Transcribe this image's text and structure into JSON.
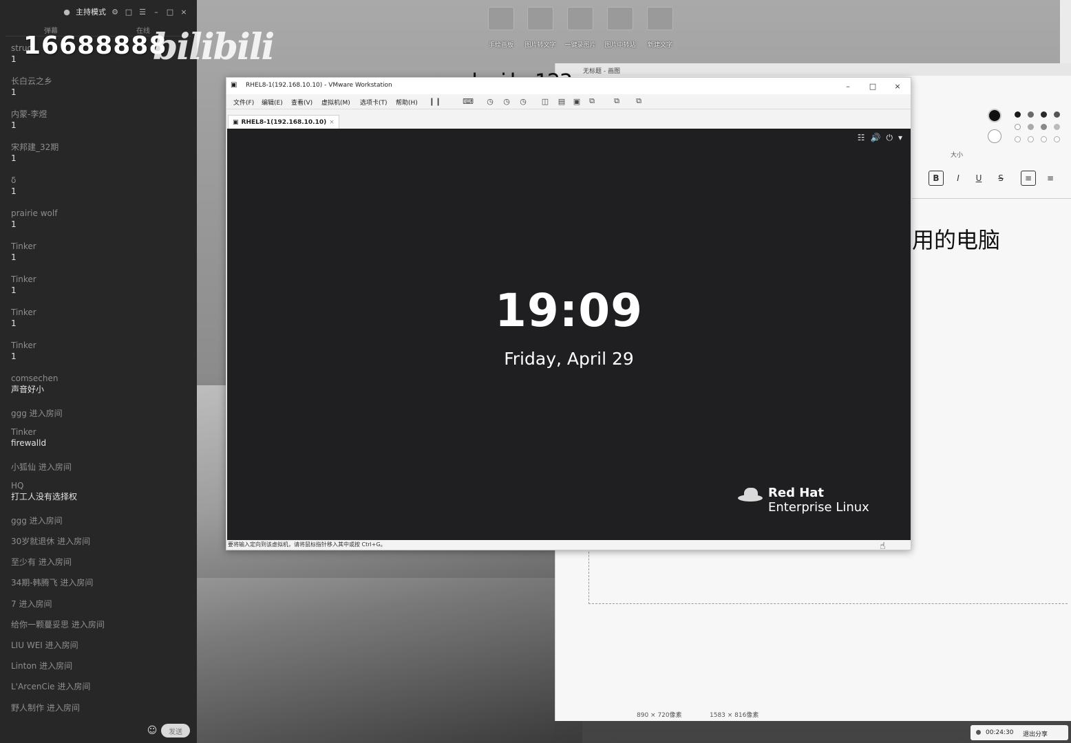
{
  "chat": {
    "title": "主持模式",
    "tabs": [
      "弹幕",
      "在线"
    ],
    "number_overlay": "16688888",
    "bili_logo": "bilibili",
    "messages": [
      {
        "user": "strug",
        "content": "1"
      },
      {
        "user": "长白云之乡",
        "content": "1"
      },
      {
        "user": "内蒙-李煜",
        "content": "1"
      },
      {
        "user": "宋邦建_32期",
        "content": "1"
      },
      {
        "user": "δ",
        "content": "1"
      },
      {
        "user": "prairie wolf",
        "content": "1"
      },
      {
        "user": "Tinker",
        "content": "1"
      },
      {
        "user": "Tinker",
        "content": "1"
      },
      {
        "user": "Tinker",
        "content": "1"
      },
      {
        "user": "Tinker",
        "content": "1"
      },
      {
        "user": "comsechen",
        "content": "声音好小"
      }
    ],
    "enter1": "ggg 进入房间",
    "msg_firewall": {
      "user": "Tinker",
      "content": "firewalld"
    },
    "enter2": "小狐仙 进入房间",
    "msg_hq": {
      "user": "HQ",
      "content": "打工人没有选择权"
    },
    "enters": [
      "ggg 进入房间",
      "30岁就退休 进入房间",
      "至少有 进入房间",
      "34期-韩腾飞 进入房间",
      "7 进入房间",
      "给你一颗蔓妥思 进入房间",
      "LIU WEI 进入房间",
      "Linton 进入房间",
      "L'ArcenCie 进入房间",
      "野人制作 进入房间"
    ],
    "send_label": "发送"
  },
  "desktop_icons": [
    "手绘画板",
    "图片转文字",
    "一键录图片",
    "图片中转站",
    "新建文字"
  ],
  "background_app": {
    "title": "无标题 - 画图",
    "heading": "用的电脑",
    "size_label": "大小",
    "status_size1": "890 × 720像素",
    "status_size2": "1583 × 816像素",
    "swatch_colors": [
      "#1a1a1a",
      "#6a6a6a",
      "#2a2a2a",
      "#555555",
      "#888888"
    ],
    "format_buttons": [
      "B",
      "I",
      "U",
      "S"
    ]
  },
  "watermark": "www.heike123.com",
  "vmware": {
    "title": "RHEL8-1(192.168.10.10) - VMware Workstation",
    "menus": [
      "文件(F)",
      "编辑(E)",
      "查看(V)",
      "虚拟机(M)",
      "选项卡(T)",
      "帮助(H)"
    ],
    "tab_label": "RHEL8-1(192.168.10.10)",
    "status_text": "要将输入定向到该虚拟机，请将鼠标指针移入其中或按 Ctrl+G。",
    "guest": {
      "clock": "19:09",
      "date": "Friday, April 29",
      "brand_name": "Red Hat",
      "brand_sub": "Enterprise Linux"
    }
  },
  "live": {
    "time": "00:24:30",
    "exit_label": "退出分享"
  }
}
